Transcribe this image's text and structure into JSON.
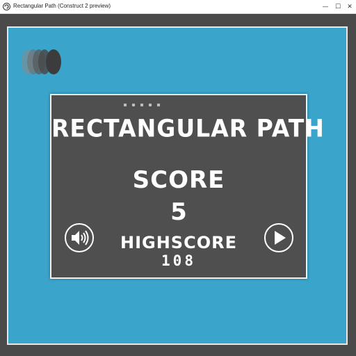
{
  "window": {
    "title": "Rectangular Path (Construct 2 preview)",
    "minimize_glyph": "—",
    "maximize_glyph": "☐",
    "close_glyph": "✕",
    "icon": "construct-app-icon"
  },
  "colors": {
    "frame": "#4a4a4a",
    "playfield": "#3aa4cb",
    "panel": "#4f4f4f",
    "text": "#ffffff"
  },
  "game": {
    "title": "RECTANGULAR PATH",
    "score_label": "SCORE",
    "score_value": "5",
    "highscore_label": "HIGHSCORE",
    "highscore_value": "108",
    "sound_icon": "speaker-icon",
    "play_icon": "play-icon"
  }
}
